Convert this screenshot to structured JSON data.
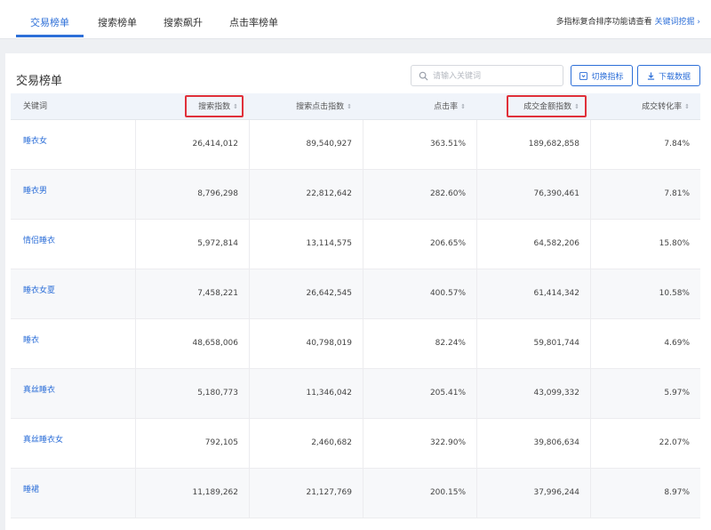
{
  "topbar": {
    "tabs": [
      {
        "label": "交易榜单",
        "active": true
      },
      {
        "label": "搜索榜单",
        "active": false
      },
      {
        "label": "搜索飙升",
        "active": false
      },
      {
        "label": "点击率榜单",
        "active": false
      }
    ],
    "hint_text": "多指标复合排序功能请查看",
    "hint_link": "关键词挖掘 ›"
  },
  "panel": {
    "title": "交易榜单",
    "search_placeholder": "请输入关键词",
    "search_value": "",
    "switch_metric_label": "切换指标",
    "download_label": "下载数据"
  },
  "table": {
    "columns": [
      "关键词",
      "搜索指数",
      "搜索点击指数",
      "点击率",
      "成交金额指数",
      "成交转化率"
    ],
    "sort_icon": "⇕",
    "highlighted_columns": [
      "搜索指数",
      "成交金额指数"
    ],
    "rows": [
      {
        "keyword": "睡衣女",
        "search_index": "26,414,012",
        "click_index": "89,540,927",
        "ctr": "363.51%",
        "gmv_index": "189,682,858",
        "cvr": "7.84%"
      },
      {
        "keyword": "睡衣男",
        "search_index": "8,796,298",
        "click_index": "22,812,642",
        "ctr": "282.60%",
        "gmv_index": "76,390,461",
        "cvr": "7.81%"
      },
      {
        "keyword": "情侣睡衣",
        "search_index": "5,972,814",
        "click_index": "13,114,575",
        "ctr": "206.65%",
        "gmv_index": "64,582,206",
        "cvr": "15.80%"
      },
      {
        "keyword": "睡衣女夏",
        "search_index": "7,458,221",
        "click_index": "26,642,545",
        "ctr": "400.57%",
        "gmv_index": "61,414,342",
        "cvr": "10.58%"
      },
      {
        "keyword": "睡衣",
        "search_index": "48,658,006",
        "click_index": "40,798,019",
        "ctr": "82.24%",
        "gmv_index": "59,801,744",
        "cvr": "4.69%"
      },
      {
        "keyword": "真丝睡衣",
        "search_index": "5,180,773",
        "click_index": "11,346,042",
        "ctr": "205.41%",
        "gmv_index": "43,099,332",
        "cvr": "5.97%"
      },
      {
        "keyword": "真丝睡衣女",
        "search_index": "792,105",
        "click_index": "2,460,682",
        "ctr": "322.90%",
        "gmv_index": "39,806,634",
        "cvr": "22.07%"
      },
      {
        "keyword": "睡裙",
        "search_index": "11,189,262",
        "click_index": "21,127,769",
        "ctr": "200.15%",
        "gmv_index": "37,996,244",
        "cvr": "8.97%"
      }
    ]
  },
  "colors": {
    "accent": "#2d6fd8",
    "highlight_box": "#e0303a",
    "header_bg": "#f0f4fa"
  },
  "icons": {
    "search": "search-icon",
    "switch": "filter-icon",
    "download": "download-icon",
    "sort": "sort-icon"
  }
}
